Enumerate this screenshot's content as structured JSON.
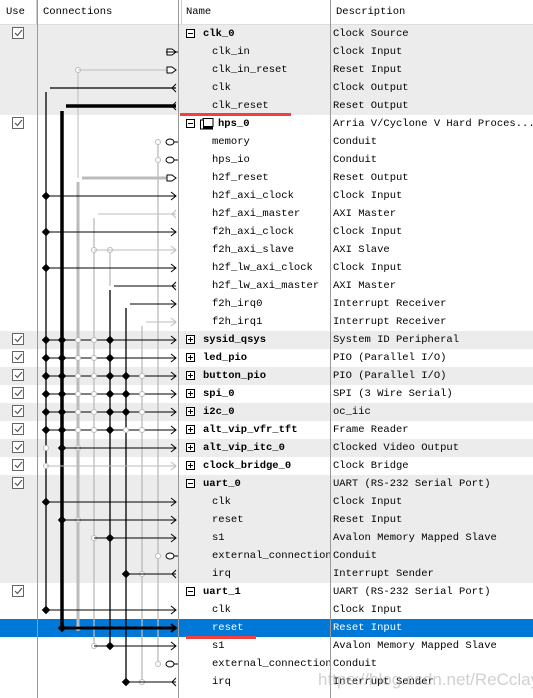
{
  "columns": {
    "use": "Use",
    "connections": "Connections",
    "name": "Name",
    "description": "Description"
  },
  "colors": {
    "selection": "#0078d7",
    "group_shade": "#ececec",
    "highlight_underline": "#f04040"
  },
  "rows": [
    {
      "name": "clk_0",
      "desc": "Clock Source",
      "group": true,
      "expanded": true,
      "checked": true,
      "shade": true
    },
    {
      "name": "clk_in",
      "desc": "Clock Input",
      "shade": true
    },
    {
      "name": "clk_in_reset",
      "desc": "Reset Input",
      "shade": true
    },
    {
      "name": "clk",
      "desc": "Clock Output",
      "shade": true
    },
    {
      "name": "clk_reset",
      "desc": "Reset Output",
      "shade": true,
      "underline": true
    },
    {
      "name": "hps_0",
      "desc": "Arria V/Cyclone V Hard Proces...",
      "group": true,
      "expanded": true,
      "checked": true,
      "icon": "processor-icon"
    },
    {
      "name": "memory",
      "desc": "Conduit"
    },
    {
      "name": "hps_io",
      "desc": "Conduit"
    },
    {
      "name": "h2f_reset",
      "desc": "Reset Output"
    },
    {
      "name": "h2f_axi_clock",
      "desc": "Clock Input"
    },
    {
      "name": "h2f_axi_master",
      "desc": "AXI Master"
    },
    {
      "name": "f2h_axi_clock",
      "desc": "Clock Input"
    },
    {
      "name": "f2h_axi_slave",
      "desc": "AXI Slave"
    },
    {
      "name": "h2f_lw_axi_clock",
      "desc": "Clock Input"
    },
    {
      "name": "h2f_lw_axi_master",
      "desc": "AXI Master"
    },
    {
      "name": "f2h_irq0",
      "desc": "Interrupt Receiver"
    },
    {
      "name": "f2h_irq1",
      "desc": "Interrupt Receiver"
    },
    {
      "name": "sysid_qsys",
      "desc": "System ID Peripheral",
      "group": true,
      "checked": true,
      "shade": true
    },
    {
      "name": "led_pio",
      "desc": "PIO (Parallel I/O)",
      "group": true,
      "checked": true
    },
    {
      "name": "button_pio",
      "desc": "PIO (Parallel I/O)",
      "group": true,
      "checked": true,
      "shade": true
    },
    {
      "name": "spi_0",
      "desc": "SPI (3 Wire Serial)",
      "group": true,
      "checked": true
    },
    {
      "name": "i2c_0",
      "desc": "oc_iic",
      "group": true,
      "checked": true,
      "shade": true
    },
    {
      "name": "alt_vip_vfr_tft",
      "desc": "Frame Reader",
      "group": true,
      "checked": true
    },
    {
      "name": "alt_vip_itc_0",
      "desc": "Clocked Video Output",
      "group": true,
      "checked": true,
      "shade": true
    },
    {
      "name": "clock_bridge_0",
      "desc": "Clock Bridge",
      "group": true,
      "checked": true
    },
    {
      "name": "uart_0",
      "desc": "UART (RS-232 Serial Port)",
      "group": true,
      "expanded": true,
      "checked": true,
      "shade": true
    },
    {
      "name": "clk",
      "desc": "Clock Input",
      "shade": true
    },
    {
      "name": "reset",
      "desc": "Reset Input",
      "shade": true
    },
    {
      "name": "s1",
      "desc": "Avalon Memory Mapped Slave",
      "shade": true
    },
    {
      "name": "external_connection",
      "desc": "Conduit",
      "shade": true
    },
    {
      "name": "irq",
      "desc": "Interrupt Sender",
      "shade": true
    },
    {
      "name": "uart_1",
      "desc": "UART (RS-232 Serial Port)",
      "group": true,
      "expanded": true,
      "checked": true
    },
    {
      "name": "clk",
      "desc": "Clock Input"
    },
    {
      "name": "reset",
      "desc": "Reset Input",
      "selected": true,
      "underline": true
    },
    {
      "name": "s1",
      "desc": "Avalon Memory Mapped Slave"
    },
    {
      "name": "external_connection",
      "desc": "Conduit"
    },
    {
      "name": "irq",
      "desc": "Interrupt Sender"
    }
  ],
  "watermark": "https://blog.csdn.net/ReCclay"
}
